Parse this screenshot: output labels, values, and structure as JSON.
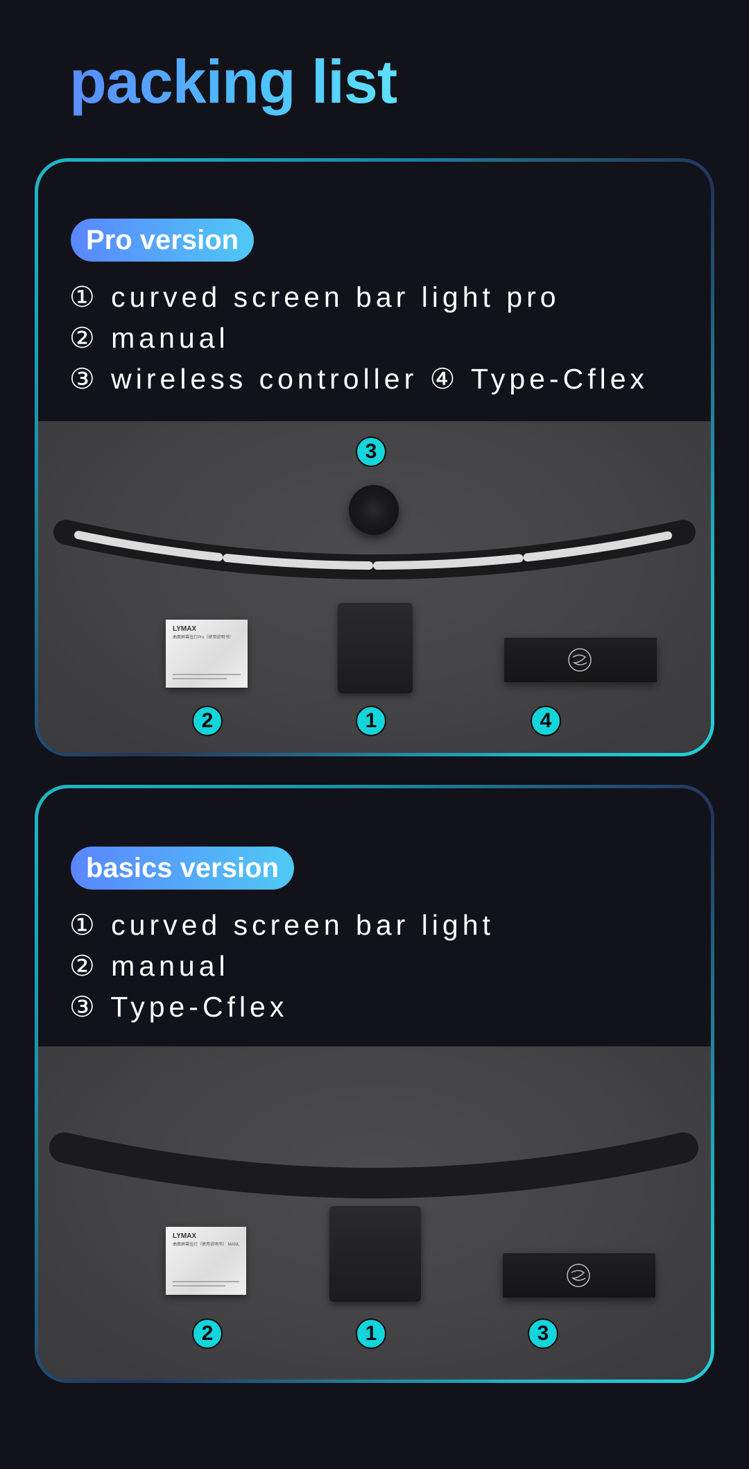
{
  "title": "packing list",
  "pro": {
    "badge": "Pro version",
    "items": [
      "① curved screen bar light pro",
      "② manual",
      "③ wireless controller   ④ Type-Cflex"
    ],
    "markers": {
      "controller": "3",
      "manual": "2",
      "light": "1",
      "cable": "4"
    },
    "manual_brand": "LYMAX",
    "manual_sub": "曲面屏幕挂灯Pro（使用说明书）"
  },
  "basics": {
    "badge": "basics version",
    "items": [
      "① curved screen bar light",
      "② manual",
      "③ Type-Cflex"
    ],
    "markers": {
      "manual": "2",
      "light": "1",
      "cable": "3"
    },
    "manual_brand": "LYMAX",
    "manual_sub": "曲面屏幕挂灯（使用说明书） MANUAL FOR CURVED SCREEN HANGING LIGHT"
  },
  "colors": {
    "accent": "#14d4dc",
    "title_start": "#5a8cff",
    "title_end": "#5ee0ff",
    "background": "#12121a"
  },
  "icons": [
    "usb-c-cable-icon"
  ]
}
